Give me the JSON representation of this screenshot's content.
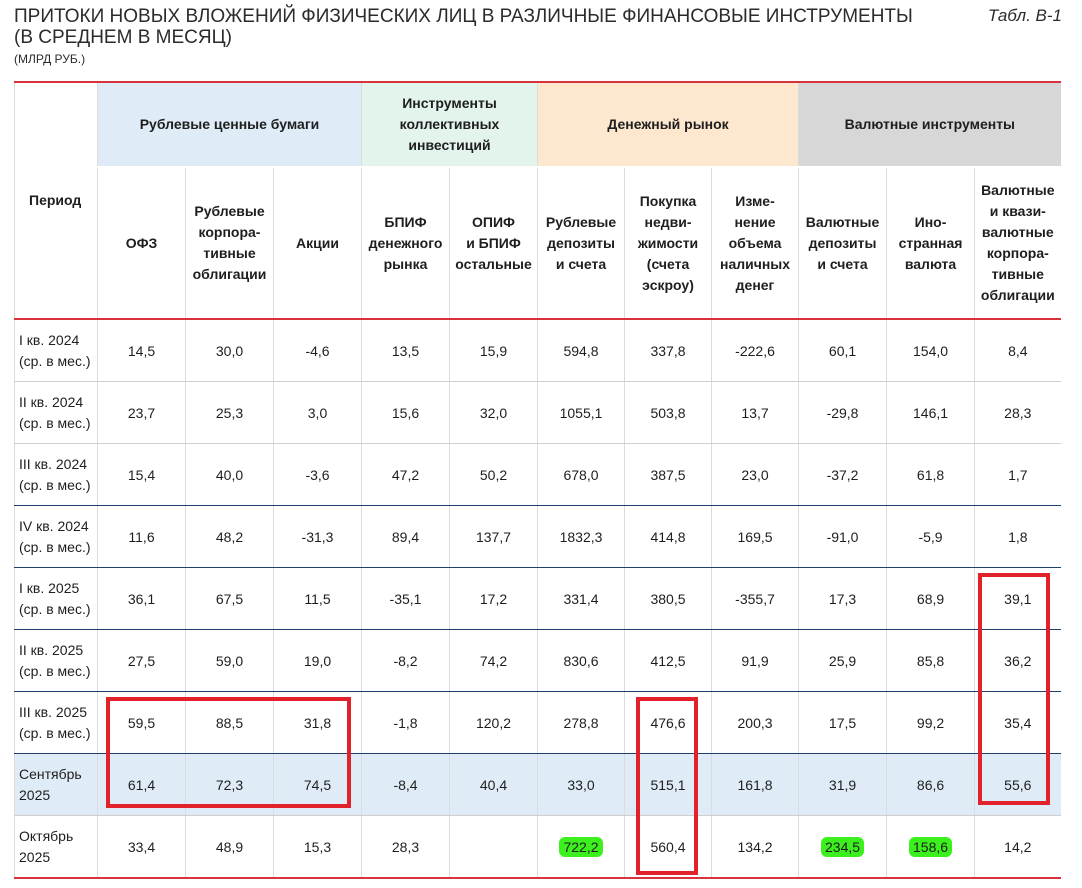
{
  "header": {
    "title_line1": "ПРИТОКИ НОВЫХ ВЛОЖЕНИЙ ФИЗИЧЕСКИХ ЛИЦ В РАЗЛИЧНЫЕ ФИНАНСОВЫЕ ИНСТРУМЕНТЫ",
    "title_line2": "(В СРЕДНЕМ В МЕСЯЦ)",
    "units": "(МЛРД РУБ.)",
    "table_number": "Табл. В-1"
  },
  "groups": {
    "period": "Период",
    "rub_securities": "Рублевые ценные бумаги",
    "collective": [
      "Инструменты",
      "коллективных",
      "инвестиций"
    ],
    "money_market": "Денежный рынок",
    "currency": "Валютные инструменты"
  },
  "columns": [
    [
      "ОФЗ"
    ],
    [
      "Рублевые",
      "корпора-",
      "тивные",
      "облигации"
    ],
    [
      "Акции"
    ],
    [
      "БПИФ",
      "денежного",
      "рынка"
    ],
    [
      "ОПИФ",
      "и БПИФ",
      "остальные"
    ],
    [
      "Рублевые",
      "депозиты",
      "и счета"
    ],
    [
      "Покупка",
      "недви-",
      "жимости",
      "(счета",
      "эскроу)"
    ],
    [
      "Изме-",
      "нение",
      "объема",
      "наличных",
      "денег"
    ],
    [
      "Валютные",
      "депозиты",
      "и счета"
    ],
    [
      "Ино-",
      "странная",
      "валюта"
    ],
    [
      "Валютные",
      "и квази-",
      "валютные",
      "корпора-",
      "тивные",
      "облигации"
    ]
  ],
  "rows": [
    {
      "period": [
        "I кв. 2024",
        "(ср. в мес.)"
      ],
      "values": [
        "14,5",
        "30,0",
        "-4,6",
        "13,5",
        "15,9",
        "594,8",
        "337,8",
        "-222,6",
        "60,1",
        "154,0",
        "8,4"
      ]
    },
    {
      "period": [
        "II кв. 2024",
        "(ср. в мес.)"
      ],
      "values": [
        "23,7",
        "25,3",
        "3,0",
        "15,6",
        "32,0",
        "1055,1",
        "503,8",
        "13,7",
        "-29,8",
        "146,1",
        "28,3"
      ]
    },
    {
      "period": [
        "III кв. 2024",
        "(ср. в мес.)"
      ],
      "values": [
        "15,4",
        "40,0",
        "-3,6",
        "47,2",
        "50,2",
        "678,0",
        "387,5",
        "23,0",
        "-37,2",
        "61,8",
        "1,7"
      ]
    },
    {
      "period": [
        "IV кв. 2024",
        "(ср. в мес.)"
      ],
      "values": [
        "11,6",
        "48,2",
        "-31,3",
        "89,4",
        "137,7",
        "1832,3",
        "414,8",
        "169,5",
        "-91,0",
        "-5,9",
        "1,8"
      ]
    },
    {
      "period": [
        "I кв. 2025",
        "(ср. в мес.)"
      ],
      "values": [
        "36,1",
        "67,5",
        "11,5",
        "-35,1",
        "17,2",
        "331,4",
        "380,5",
        "-355,7",
        "17,3",
        "68,9",
        "39,1"
      ]
    },
    {
      "period": [
        "II кв. 2025",
        "(ср. в мес.)"
      ],
      "values": [
        "27,5",
        "59,0",
        "19,0",
        "-8,2",
        "74,2",
        "830,6",
        "412,5",
        "91,9",
        "25,9",
        "85,8",
        "36,2"
      ]
    },
    {
      "period": [
        "III кв. 2025",
        "(ср. в мес.)"
      ],
      "values": [
        "59,5",
        "88,5",
        "31,8",
        "-1,8",
        "120,2",
        "278,8",
        "476,6",
        "200,3",
        "17,5",
        "99,2",
        "35,4"
      ]
    },
    {
      "period": [
        "Сентябрь",
        "2025"
      ],
      "values": [
        "61,4",
        "72,3",
        "74,5",
        "-8,4",
        "40,4",
        "33,0",
        "515,1",
        "161,8",
        "31,9",
        "86,6",
        "55,6"
      ]
    },
    {
      "period": [
        "Октябрь",
        "2025"
      ],
      "values": [
        "33,4",
        "48,9",
        "15,3",
        "28,3",
        "",
        "722,2",
        "560,4",
        "134,2",
        "234,5",
        "158,6",
        "14,2"
      ]
    }
  ],
  "highlight_colors": {
    "box": "#e1222a",
    "marker": "#3cf01e",
    "row_fill": "#dfecf7"
  }
}
